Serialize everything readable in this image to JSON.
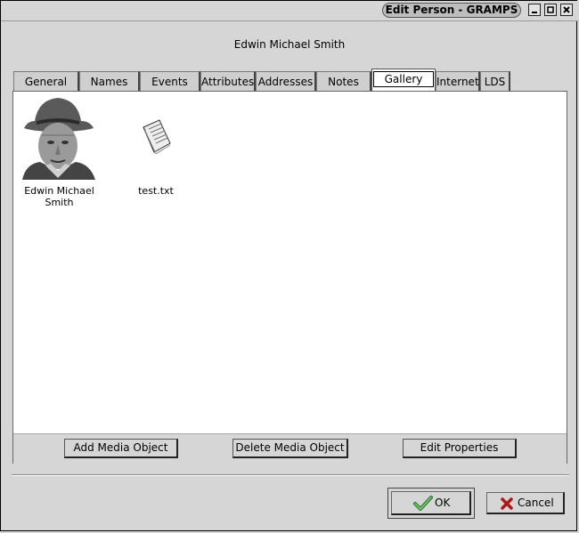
{
  "window": {
    "title": "Edit Person - GRAMPS"
  },
  "person": {
    "name": "Edwin Michael Smith"
  },
  "tabs": [
    {
      "label": "General"
    },
    {
      "label": "Names"
    },
    {
      "label": "Events"
    },
    {
      "label": "Attributes"
    },
    {
      "label": "Addresses"
    },
    {
      "label": "Notes"
    },
    {
      "label": "Gallery",
      "active": true
    },
    {
      "label": "Internet"
    },
    {
      "label": "LDS"
    }
  ],
  "gallery": {
    "items": [
      {
        "caption": "Edwin Michael Smith",
        "icon": "portrait-photo"
      },
      {
        "caption": "test.txt",
        "icon": "text-document-icon"
      }
    ],
    "buttons": {
      "add": "Add Media Object",
      "delete": "Delete Media Object",
      "edit": "Edit Properties"
    }
  },
  "dialog": {
    "ok": "OK",
    "cancel": "Cancel"
  }
}
